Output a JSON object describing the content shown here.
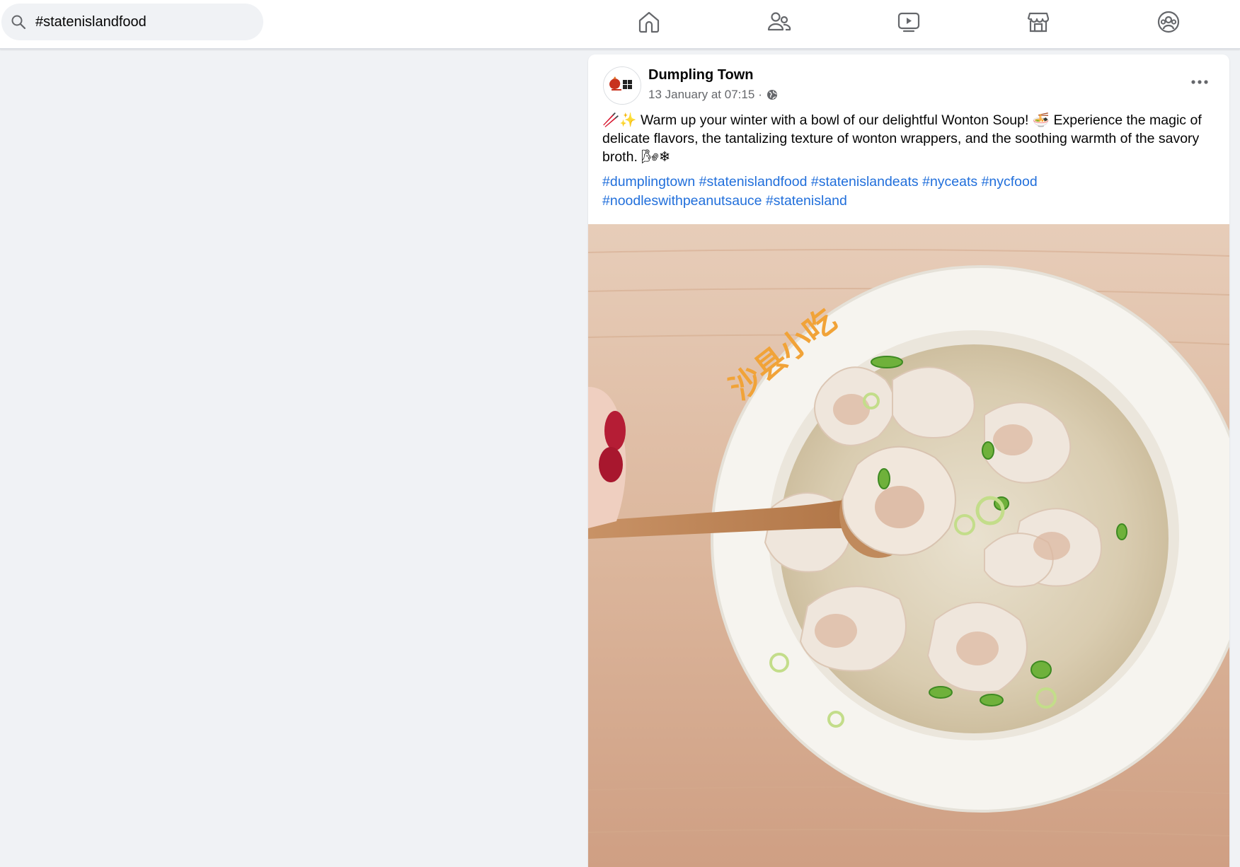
{
  "search": {
    "value": "#statenislandfood"
  },
  "nav": {
    "items": [
      {
        "icon": "home-icon"
      },
      {
        "icon": "friends-icon"
      },
      {
        "icon": "video-icon"
      },
      {
        "icon": "marketplace-icon"
      },
      {
        "icon": "groups-icon"
      }
    ]
  },
  "post": {
    "author": "Dumpling Town",
    "timestamp": "13 January at 07:15",
    "separator": "·",
    "visibility_icon": "globe-icon",
    "text_prefix_emoji": "🥢✨",
    "text_main": " Warm up your winter with a bowl of our delightful Wonton Soup! ",
    "text_mid_emoji": "🍜",
    "text_rest": " Experience the magic of delicate flavors, the tantalizing texture of wonton wrappers, and the soothing warmth of the savory broth. ",
    "text_end_emoji": "🌬❄",
    "hashtags": [
      "#dumplingtown",
      "#statenislandfood",
      "#statenislandeats",
      "#nyceats",
      "#nycfood",
      "#noodleswithpeanutsauce",
      "#statenisland"
    ],
    "photo_bowl_print": "沙县小吃"
  },
  "colors": {
    "background": "#f0f2f5",
    "card": "#ffffff",
    "hashtag": "#216fdb",
    "secondary_text": "#65676b",
    "icon": "#65676b"
  }
}
